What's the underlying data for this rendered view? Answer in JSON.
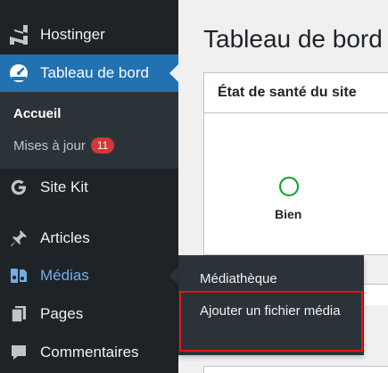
{
  "sidebar": {
    "hostinger": {
      "label": "Hostinger",
      "icon": "hostinger-logo-icon"
    },
    "dashboard": {
      "label": "Tableau de bord",
      "icon": "dashboard-gauge-icon"
    },
    "submenu": {
      "accueil": "Accueil",
      "updates": "Mises à jour",
      "updates_count": "11"
    },
    "sitekit": {
      "label": "Site Kit",
      "icon": "google-g-icon"
    },
    "articles": {
      "label": "Articles",
      "icon": "pushpin-icon"
    },
    "medias": {
      "label": "Médias",
      "icon": "media-icon"
    },
    "pages": {
      "label": "Pages",
      "icon": "pages-icon"
    },
    "comments": {
      "label": "Commentaires",
      "icon": "comment-icon"
    }
  },
  "flyout": {
    "mediatheque": "Médiathèque",
    "ajouter": "Ajouter un fichier média"
  },
  "main": {
    "title": "Tableau de bord",
    "health_panel": {
      "title": "État de santé du site",
      "status": "Bien"
    }
  },
  "colors": {
    "sidebar_bg": "#1d2327",
    "active_bg": "#2271b1",
    "badge": "#d63638",
    "health_good": "#00a32a",
    "highlight": "#e0161c"
  }
}
